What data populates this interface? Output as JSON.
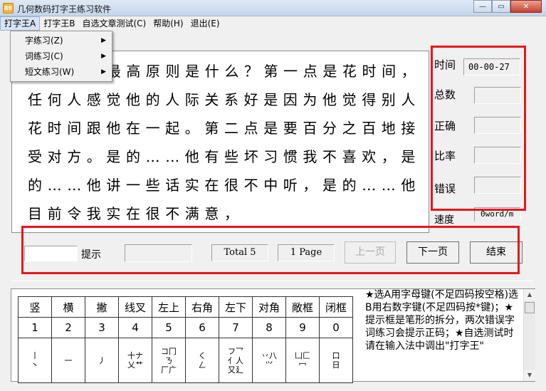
{
  "window": {
    "title": "几何数码打字王练习软件",
    "icon_text": "89",
    "buttons": [
      "—",
      "▭",
      "✕"
    ]
  },
  "menubar": {
    "items": [
      "打字王A",
      "打字王B",
      "自选文章测试(C)",
      "帮助(H)",
      "退出(E)"
    ]
  },
  "dropdown": {
    "items": [
      {
        "label": "字练习(Z)",
        "arrow": "▶"
      },
      {
        "label": "词练习(C)",
        "arrow": "▶"
      },
      {
        "label": "短文练习(W)",
        "arrow": "▶"
      }
    ]
  },
  "passage": {
    "text": "  相处的最高原则是什么？第一点是花时间，任何人感觉他的人际关系好是因为他觉得别人花时间跟他在一起。第二点是要百分之百地接受对方。是的……他有些坏习惯我不喜欢，是的……他讲一些话实在很不中听，是的……他目前令我实在很不满意，"
  },
  "stats": {
    "time_label": "时间",
    "time_value": "00-00-27",
    "total_label": "总数",
    "total_value": "",
    "correct_label": "正确",
    "correct_value": "",
    "ratio_label": "比率",
    "ratio_value": "",
    "error_label": "错误",
    "error_value": "",
    "speed_label": "速度",
    "speed_value": "0word/m"
  },
  "controls": {
    "input_value": "",
    "hint_label": "提示",
    "hint_value": "",
    "total_display": "Total 5",
    "page_display": "1 Page",
    "prev_button": "上一页",
    "next_button": "下一页",
    "end_button": "结束"
  },
  "key_table": {
    "headers": [
      "竖",
      "横",
      "撇",
      "线叉",
      "左上",
      "右角",
      "左下",
      "对角",
      "敞框",
      "闭框"
    ],
    "numbers": [
      "1",
      "2",
      "3",
      "4",
      "5",
      "6",
      "7",
      "8",
      "9",
      "0"
    ],
    "shapes": [
      "丨\n丶 ",
      "一",
      "丿",
      "十ナ\n乂艹",
      "コ冂\nㄋ\n厂广",
      "く\nㄥ",
      "フ乛\n亻人\n又廴",
      "丷八\n⺍",
      "凵匚\n冖",
      "口\n日"
    ]
  },
  "tips": {
    "text": "★选A用字母键(不足四码按空格)选B用右数字键(不足四码按*键)；★提示框是笔形的拆分，两次错误字词练习会提示正码；★自选测试时请在输入法中调出\"打字王\""
  },
  "colors": {
    "highlight": "#e8161b",
    "window_bg": "#f0f0f0"
  }
}
